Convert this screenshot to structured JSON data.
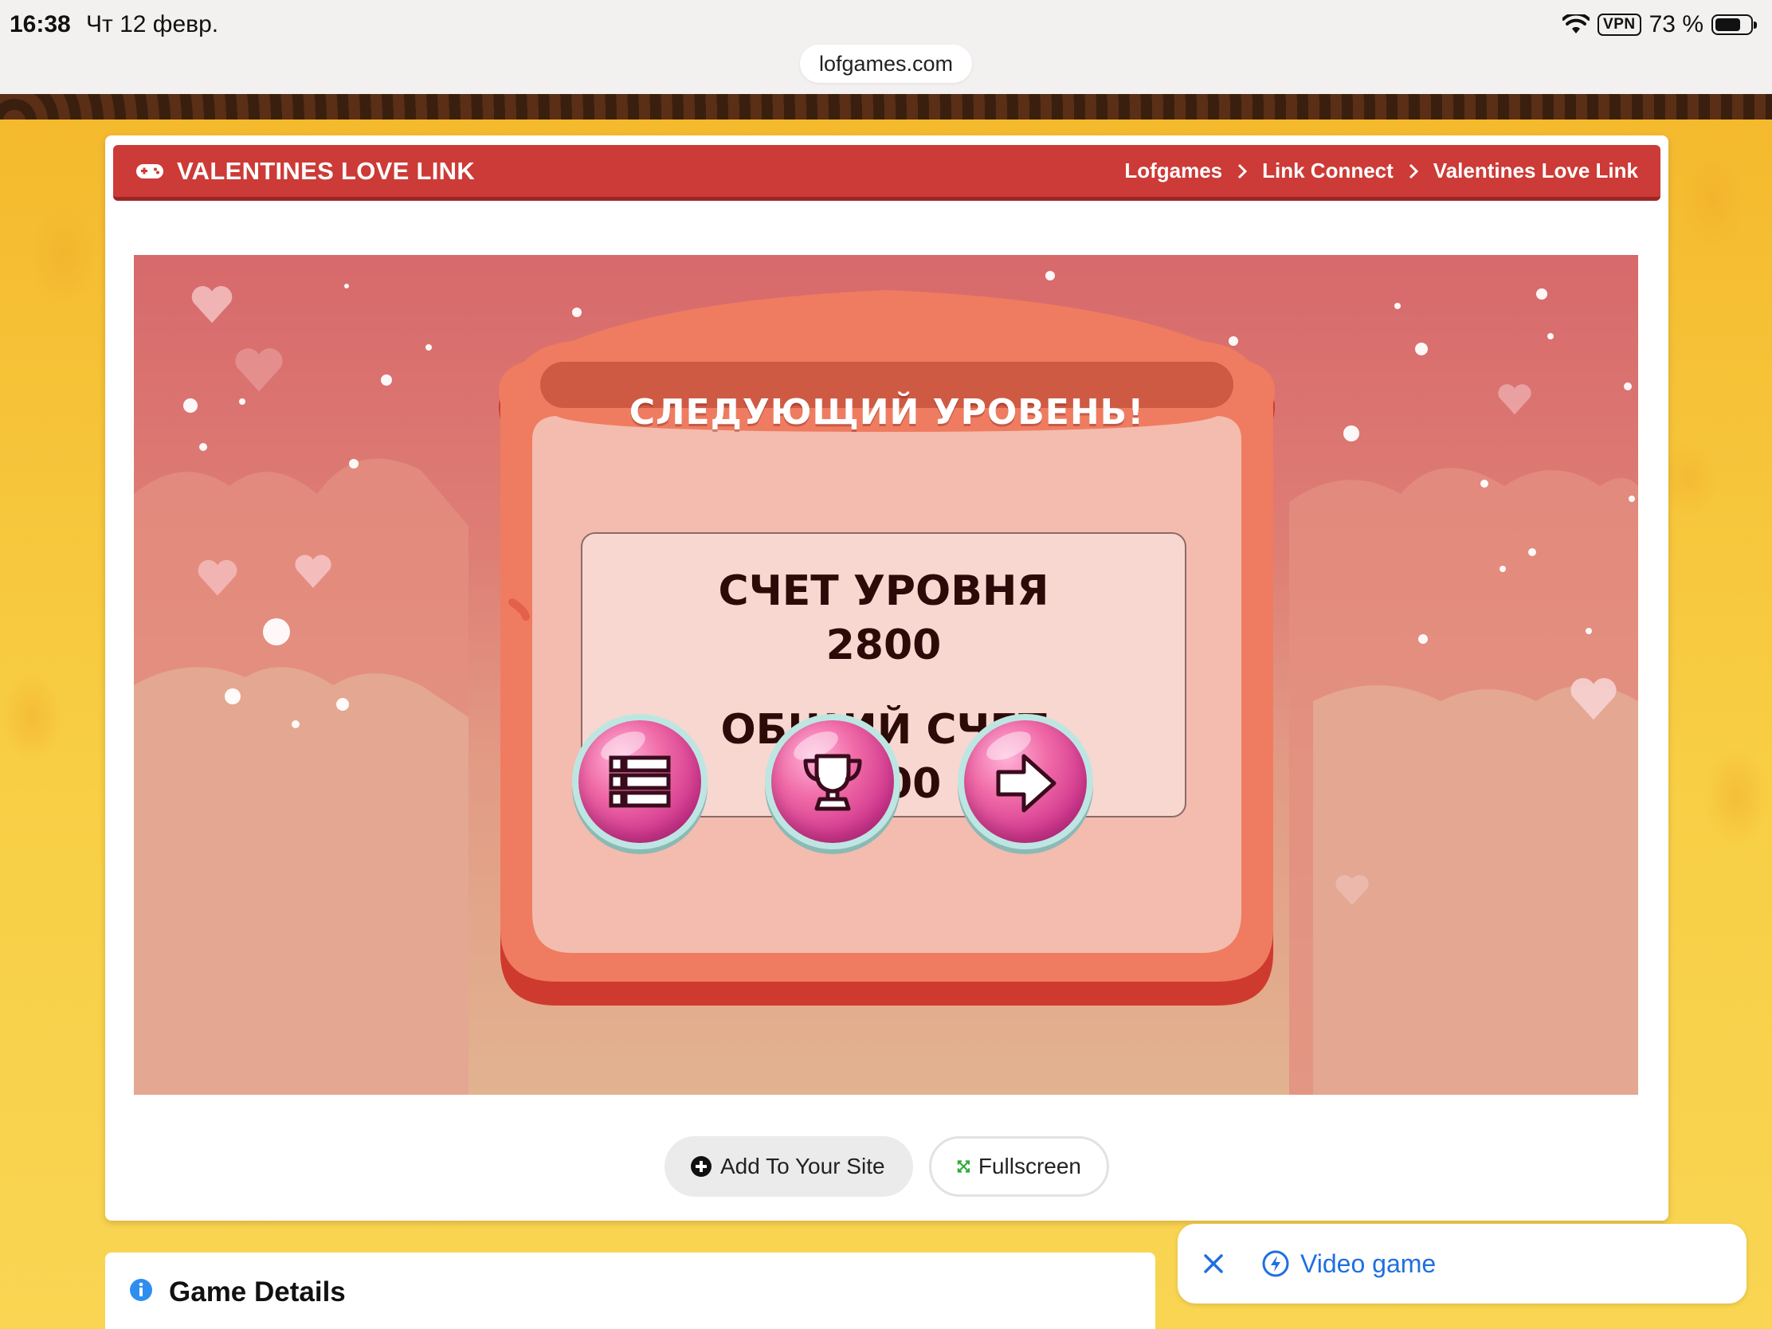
{
  "status_bar": {
    "time": "16:38",
    "date": "Чт 12 февр.",
    "vpn": "VPN",
    "battery": "73 %",
    "battery_level": 0.73
  },
  "browser": {
    "url": "lofgames.com"
  },
  "game_card": {
    "title": "VALENTINES LOVE LINK",
    "title_icon": "gamepad-icon",
    "breadcrumb": [
      "Lofgames",
      "Link Connect",
      "Valentines Love Link"
    ]
  },
  "game": {
    "heading": "СЛЕДУЮЩИЙ УРОВЕНЬ!",
    "level_score_label": "СЧЕТ УРОВНЯ",
    "level_score_value": "2800",
    "total_score_label": "ОБЩИЙ СЧЕТ",
    "total_score_value": "2800",
    "buttons": [
      "menu-list-icon",
      "trophy-icon",
      "arrow-right-icon"
    ]
  },
  "actions": {
    "add_to_site": "Add To Your Site",
    "fullscreen": "Fullscreen"
  },
  "details": {
    "title": "Game Details"
  },
  "ad": {
    "label": "Video game"
  },
  "colors": {
    "title_bar": "#cc3b37",
    "page_background": "#f8cf45",
    "panel": "#ee7b60",
    "score_text": "#2b0a07",
    "link_blue": "#1f6fe0"
  }
}
